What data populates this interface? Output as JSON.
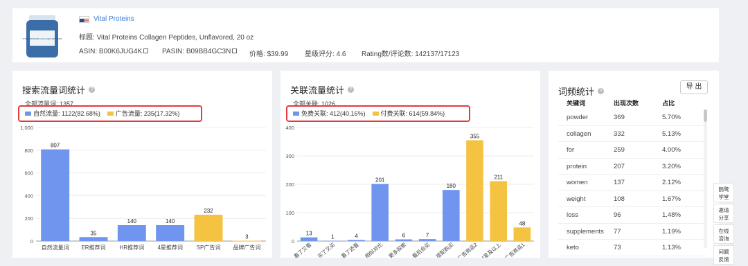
{
  "product": {
    "brand": "Vital Proteins",
    "title_label": "标题:",
    "title": "Vital Proteins Collagen Peptides, Unflavored, 20 oz",
    "asin_label": "ASIN:",
    "asin": "B00K6JUG4K",
    "pasin_label": "PASIN:",
    "pasin": "B09BB4GC3N",
    "price_label": "价格:",
    "price": "$39.99",
    "rating_label": "星级评分:",
    "rating": "4.6",
    "ratings_label": "Rating数/评论数:",
    "ratings": "142137/17123",
    "image_text": "VITAL PROTEINS COLLAGEN PEPTIDES"
  },
  "search_traffic": {
    "title": "搜索流量词统计",
    "total_label": "全部流量词:",
    "total": "1357",
    "legend": [
      {
        "label": "自然流量: 1122(82.68%)",
        "color": "#6f95ee"
      },
      {
        "label": "广告流量: 235(17.32%)",
        "color": "#f5c342"
      }
    ]
  },
  "related_traffic": {
    "title": "关联流量统计",
    "total_label": "全部关联:",
    "total": "1026",
    "legend": [
      {
        "label": "免费关联: 412(40.16%)",
        "color": "#6f95ee"
      },
      {
        "label": "付费关联: 614(59.84%)",
        "color": "#f5c342"
      }
    ]
  },
  "chart_data": [
    {
      "type": "bar",
      "title": "搜索流量词统计",
      "categories": [
        "自然流量词",
        "ER推荐词",
        "HR推荐词",
        "4星推荐词",
        "SP广告词",
        "品牌广告词"
      ],
      "values": [
        807,
        35,
        140,
        140,
        232,
        3
      ],
      "colors": [
        "#6f95ee",
        "#6f95ee",
        "#6f95ee",
        "#6f95ee",
        "#f5c342",
        "#f5c342"
      ],
      "ylim": [
        0,
        1000
      ],
      "yticks": [
        "0",
        "200",
        "400",
        "600",
        "800",
        "1,000"
      ],
      "grid": true,
      "legend": "top-left"
    },
    {
      "type": "bar",
      "title": "关联流量统计",
      "categories": [
        "看了又看",
        "买了又买",
        "看了还看",
        "相似对比",
        "更多探索",
        "看后会买",
        "搭配购买",
        "广告商品2",
        "4星及以上",
        "广告商品1"
      ],
      "values": [
        13,
        1,
        4,
        201,
        6,
        7,
        180,
        355,
        211,
        48
      ],
      "colors": [
        "#6f95ee",
        "#6f95ee",
        "#6f95ee",
        "#6f95ee",
        "#6f95ee",
        "#6f95ee",
        "#6f95ee",
        "#f5c342",
        "#f5c342",
        "#f5c342"
      ],
      "ylim": [
        0,
        400
      ],
      "yticks": [
        "0",
        "100",
        "200",
        "300",
        "400"
      ],
      "grid": true,
      "legend": "top-left"
    }
  ],
  "word_freq": {
    "title": "词频统计",
    "export_label": "导 出",
    "headers": [
      "关键词",
      "出现次数",
      "占比"
    ],
    "rows": [
      [
        "powder",
        "369",
        "5.70%"
      ],
      [
        "collagen",
        "332",
        "5.13%"
      ],
      [
        "for",
        "259",
        "4.00%"
      ],
      [
        "protein",
        "207",
        "3.20%"
      ],
      [
        "women",
        "137",
        "2.12%"
      ],
      [
        "weight",
        "108",
        "1.67%"
      ],
      [
        "loss",
        "96",
        "1.48%"
      ],
      [
        "supplements",
        "77",
        "1.19%"
      ],
      [
        "keto",
        "73",
        "1.13%"
      ]
    ]
  },
  "side_panel": [
    "鸥鹭\n学堂",
    "邀请\n分享",
    "在线\n咨询",
    "问题\n反馈"
  ]
}
